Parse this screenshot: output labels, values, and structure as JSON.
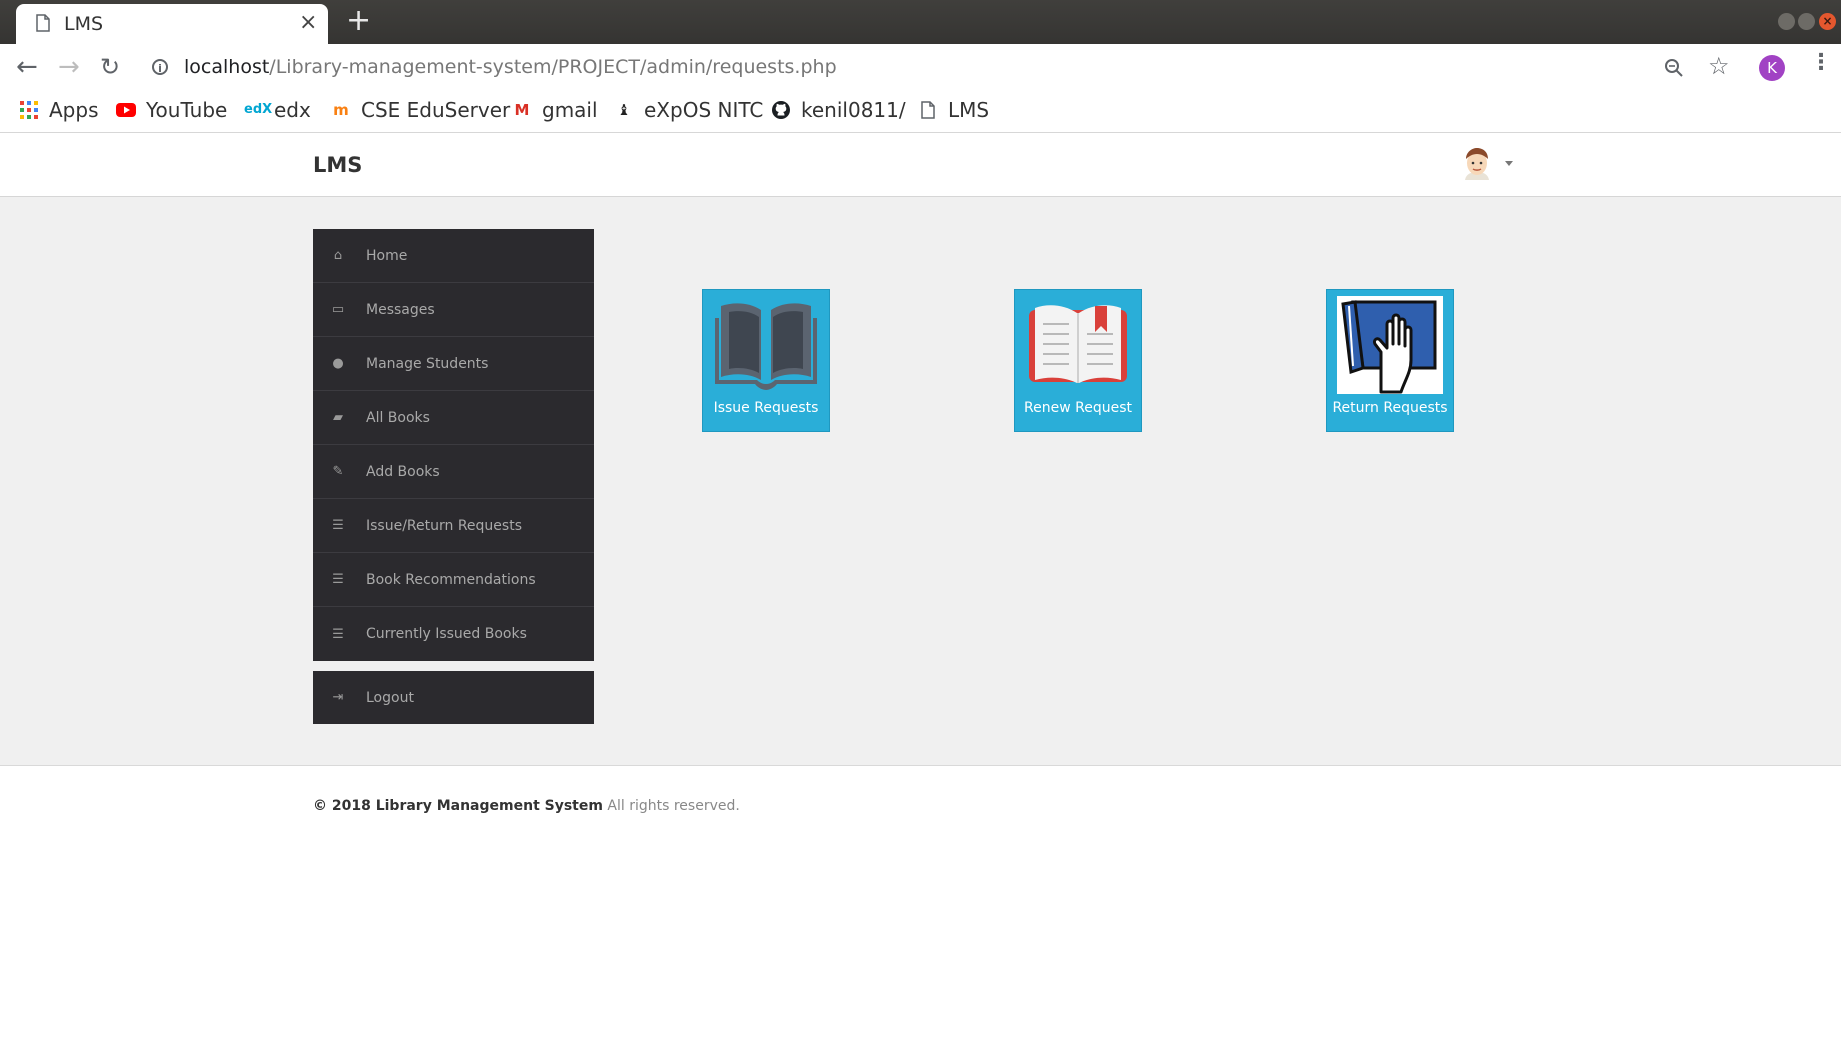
{
  "browser": {
    "tab_title": "LMS",
    "tab_close": "×",
    "new_tab": "+",
    "url_host": "localhost",
    "url_path": "/Library-management-system/PROJECT/admin/requests.php",
    "profile_initial": "K",
    "bookmarks": [
      {
        "label": "Apps",
        "icon": "apps-grid-icon"
      },
      {
        "label": "YouTube",
        "icon": "youtube-icon"
      },
      {
        "label": "edx",
        "icon": "edx-icon"
      },
      {
        "label": "CSE EduServer",
        "icon": "moodle-icon"
      },
      {
        "label": "gmail",
        "icon": "gmail-icon"
      },
      {
        "label": "eXpOS NITC",
        "icon": "expos-icon"
      },
      {
        "label": "kenil0811/",
        "icon": "github-icon"
      },
      {
        "label": "LMS",
        "icon": "page-icon"
      }
    ]
  },
  "header": {
    "brand": "LMS"
  },
  "sidebar": {
    "items": [
      {
        "label": "Home",
        "icon": "home-icon"
      },
      {
        "label": "Messages",
        "icon": "inbox-icon"
      },
      {
        "label": "Manage Students",
        "icon": "user-icon"
      },
      {
        "label": "All Books",
        "icon": "book-icon"
      },
      {
        "label": "Add Books",
        "icon": "edit-icon"
      },
      {
        "label": "Issue/Return Requests",
        "icon": "tasks-icon"
      },
      {
        "label": "Book Recommendations",
        "icon": "list-icon"
      },
      {
        "label": "Currently Issued Books",
        "icon": "list-icon"
      }
    ],
    "logout": {
      "label": "Logout",
      "icon": "logout-icon"
    }
  },
  "tiles": [
    {
      "label": "Issue Requests",
      "icon": "open-book-icon"
    },
    {
      "label": "Renew Request",
      "icon": "book-bookmark-icon"
    },
    {
      "label": "Return Requests",
      "icon": "hand-book-icon"
    }
  ],
  "footer": {
    "copyright": "© 2018 Library Management System",
    "rights": "All rights reserved."
  },
  "colors": {
    "tile_bg": "#2aaed8",
    "sidebar_bg": "#2b2a2e",
    "content_bg": "#f0f0f0"
  }
}
